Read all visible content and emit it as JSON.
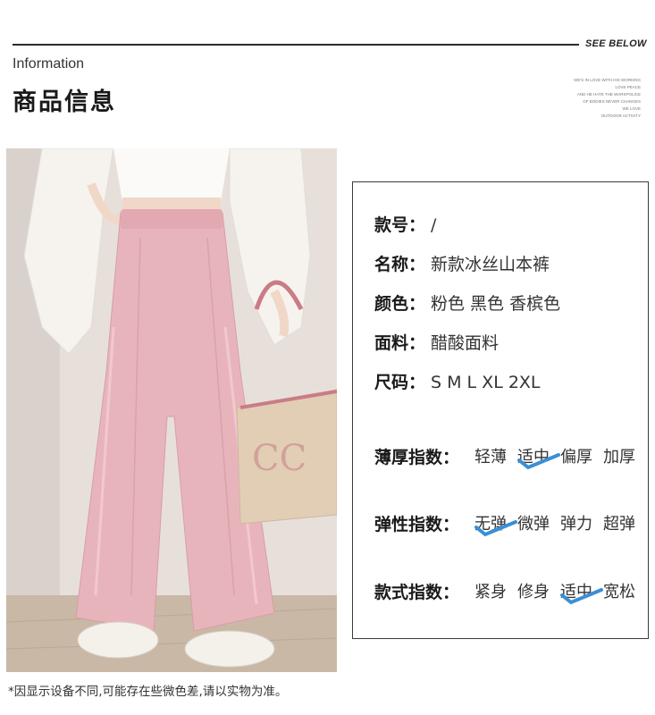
{
  "header": {
    "see_below": "SEE BELOW",
    "info_en": "Information",
    "info_cn": "商品信息",
    "blurb_lines": [
      "WE'S IN LOVE WITH HIS WORKING",
      "LOVE PEACE",
      "AND HE HATE THE WARSPOLICE",
      "OF BODIES NEVER CHANGES",
      "WE LOVE",
      "OUTDOOR ACTIVITY"
    ]
  },
  "specs": [
    {
      "key": "款号：",
      "value": "/"
    },
    {
      "key": "名称：",
      "value": "新款冰丝山本裤"
    },
    {
      "key": "颜色：",
      "value": "粉色 黑色 香槟色"
    },
    {
      "key": "面料：",
      "value": "醋酸面料"
    },
    {
      "key": "尺码：",
      "value": "S M L XL 2XL"
    }
  ],
  "indices": [
    {
      "key": "薄厚指数：",
      "options": [
        "轻薄",
        "适中",
        "偏厚",
        "加厚"
      ],
      "selected": 1
    },
    {
      "key": "弹性指数：",
      "options": [
        "无弹",
        "微弹",
        "弹力",
        "超弹"
      ],
      "selected": 0
    },
    {
      "key": "款式指数：",
      "options": [
        "紧身",
        "修身",
        "适中",
        "宽松"
      ],
      "selected": 2
    }
  ],
  "colors": {
    "check": "#3a8fd6",
    "rule": "#2b2b2b"
  },
  "footnote": "*因显示设备不同,可能存在些微色差,请以实物为准。"
}
